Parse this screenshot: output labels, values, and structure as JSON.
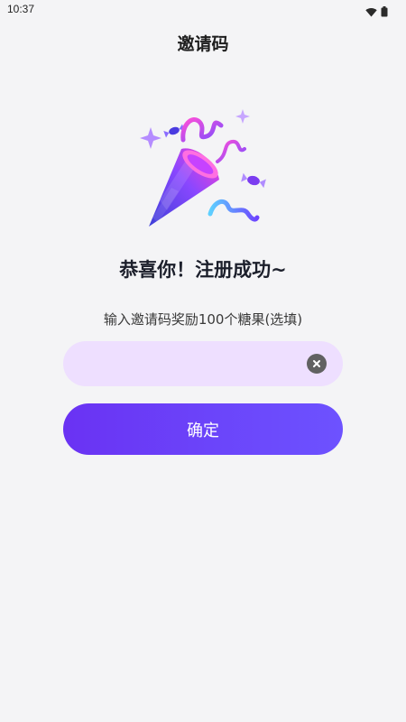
{
  "status_bar": {
    "time": "10:37",
    "icons": [
      "wifi-icon",
      "battery-icon"
    ]
  },
  "header": {
    "title": "邀请码"
  },
  "hero": {
    "icon": "party-popper-icon",
    "colors": {
      "cone_dark": "#3d3fd8",
      "cone_light": "#b04bff",
      "cone_pink": "#ff3fd1",
      "sparkle": "#b58cff"
    }
  },
  "main": {
    "headline": "恭喜你！注册成功~",
    "subtitle": "输入邀请码奖励100个糖果(选填)",
    "invite_input": {
      "value": "",
      "placeholder": ""
    },
    "confirm_label": "确定"
  },
  "colors": {
    "background": "#f4f4f6",
    "input_background": "#eedfff",
    "accent": "#6a32f3",
    "clear_button": "#616161"
  }
}
